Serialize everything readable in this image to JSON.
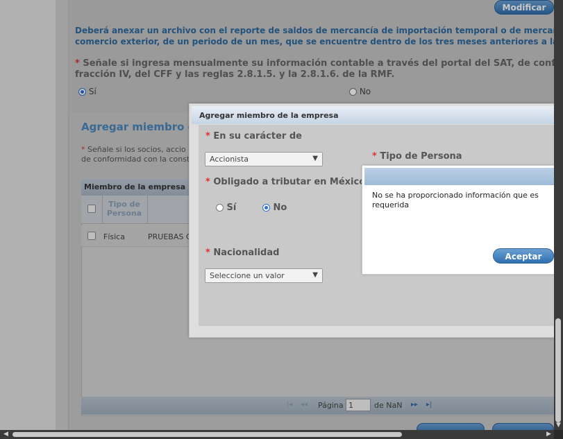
{
  "top": {
    "modify_button": "Modificar"
  },
  "notice": {
    "line1": "Deberá anexar un archivo con el reporte de saldos de mercancía de importación temporal o de mercancías obje",
    "line2": "comercio exterior, de un periodo de un mes, que se encuentre dentro de los tres meses anteriores a la presenta"
  },
  "question_sat": {
    "line1": "Señale si ingresa mensualmente su información contable a través del portal del SAT, de conformida",
    "line2": "fracción IV, del CFF y las reglas 2.8.1.5. y la 2.8.1.6. de la RMF.",
    "asterisk": "*",
    "options": [
      {
        "label": "Sí",
        "selected": true
      },
      {
        "label": "No",
        "selected": false
      }
    ]
  },
  "section": {
    "title": "Agregar miembro de",
    "note_line1": "Señale si los socios, accio",
    "note_line2": "de conformidad con la const",
    "asterisk": "*"
  },
  "grid": {
    "caption": "Miembro de la empresa",
    "header_tipo": "Tipo de Persona",
    "rows": [
      {
        "tipo": "Física",
        "nombre": "PRUEBAS C"
      }
    ],
    "pager": {
      "page_label": "Página",
      "page_value": "1",
      "of_label": "de NaN"
    }
  },
  "dialog": {
    "title": "Agregar miembro de la empresa",
    "caracter_label": "En su carácter de",
    "caracter_value": "Accionista",
    "tipo_persona_label": "Tipo de Persona",
    "tributar_label": "Obligado a tributar en México",
    "tributar_options": [
      {
        "label": "Sí",
        "selected": false
      },
      {
        "label": "No",
        "selected": true
      }
    ],
    "nacionalidad_label": "Nacionalidad",
    "nacionalidad_value": "Seleccione un valor",
    "asterisk": "*"
  },
  "alert": {
    "message": "No se ha proporcionado información que es requerida",
    "accept_button": "Aceptar"
  }
}
